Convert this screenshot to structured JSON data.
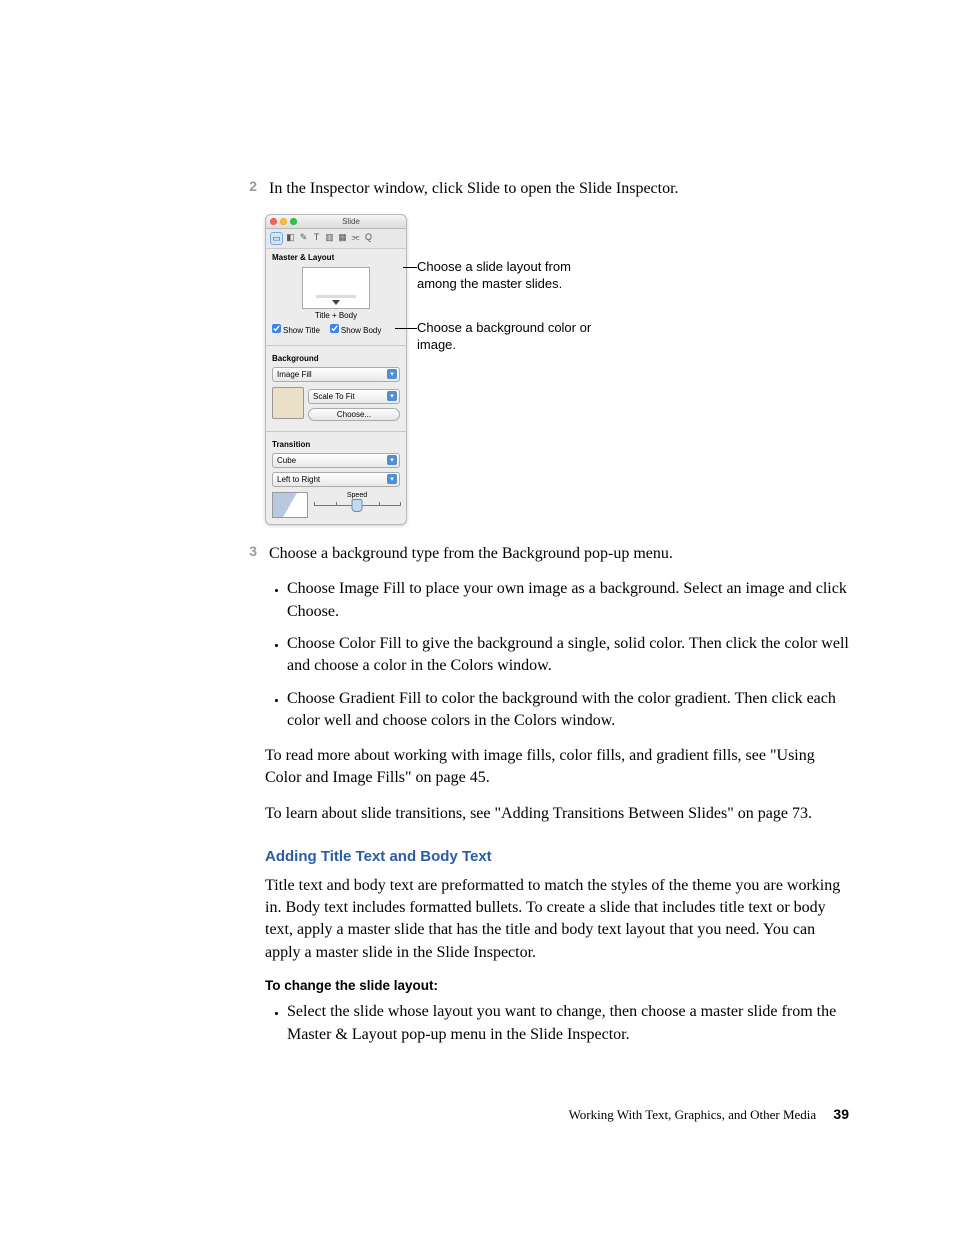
{
  "steps": {
    "s2": {
      "num": "2",
      "text": "In the Inspector window, click Slide to open the Slide Inspector."
    },
    "s3": {
      "num": "3",
      "text": "Choose a background type from the Background pop-up menu."
    }
  },
  "inspector": {
    "window_title": "Slide",
    "master_section": "Master & Layout",
    "master_label": "Title + Body",
    "show_title": "Show Title",
    "show_body": "Show Body",
    "background_section": "Background",
    "image_fill": "Image Fill",
    "scale_to_fit": "Scale To Fit",
    "choose_btn": "Choose...",
    "transition_section": "Transition",
    "transition_type": "Cube",
    "transition_dir": "Left to Right",
    "speed_label": "Speed"
  },
  "callouts": {
    "c1": "Choose a slide layout from among the master slides.",
    "c2": "Choose a background color or image."
  },
  "bullets3": {
    "b1": "Choose Image Fill to place your own image as a background. Select an image and click Choose.",
    "b2": "Choose Color Fill to give the background a single, solid color. Then click the color well and choose a color in the Colors window.",
    "b3": "Choose Gradient Fill to color the background with the color gradient. Then click each color well and choose colors in the Colors window."
  },
  "paras": {
    "p1": "To read more about working with image fills, color fills, and gradient fills, see \"Using Color and Image Fills\" on page 45.",
    "p2": "To learn about slide transitions, see \"Adding Transitions Between Slides\" on page 73."
  },
  "subhead": "Adding Title Text and Body Text",
  "bodytext_para": "Title text and body text are preformatted to match the styles of the theme you are working in. Body text includes formatted bullets. To create a slide that includes title text or body text, apply a master slide that has the title and body text layout that you need. You can apply a master slide in the Slide Inspector.",
  "boldline": "To change the slide layout:",
  "final_bullet": "Select the slide whose layout you want to change, then choose a master slide from the Master & Layout pop-up menu in the Slide Inspector.",
  "footer": {
    "chapter": "Working With Text, Graphics, and Other Media",
    "page": "39"
  }
}
